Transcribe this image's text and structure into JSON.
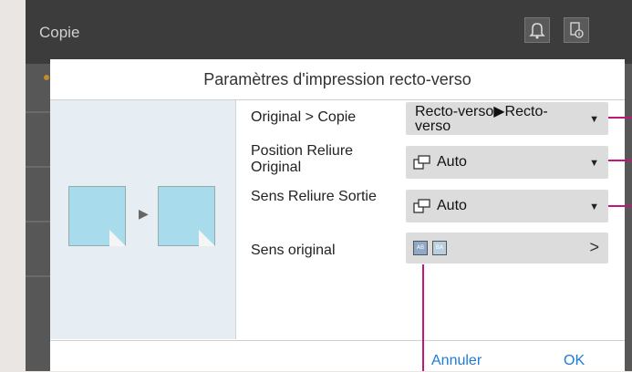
{
  "app": {
    "title": "Copie"
  },
  "topbar_icons": [
    "bell-icon",
    "settings-info-icon"
  ],
  "dialog": {
    "title": "Paramètres d'impression recto-verso",
    "rows": [
      {
        "label": "Original > Copie",
        "value": "Recto-verso▶Recto-verso",
        "control": "dropdown"
      },
      {
        "label": "Position Reliure Original",
        "value": "Auto",
        "control": "dropdown",
        "icon": "binding-position-icon"
      },
      {
        "label": "Sens Reliure Sortie",
        "value": "Auto",
        "control": "dropdown",
        "icon": "binding-position-icon"
      },
      {
        "label": "Sens original",
        "value": "",
        "control": "selector",
        "icons": [
          "orientation-ab-icon",
          "orientation-ba-icon"
        ]
      }
    ],
    "preview_icons": [
      "source-document-icon",
      "output-document-icon"
    ],
    "cancel_label": "Annuler",
    "ok_label": "OK"
  },
  "colors": {
    "accent": "#1e7bd6",
    "callout": "#c0177a",
    "preview_doc": "#a8dcec"
  }
}
